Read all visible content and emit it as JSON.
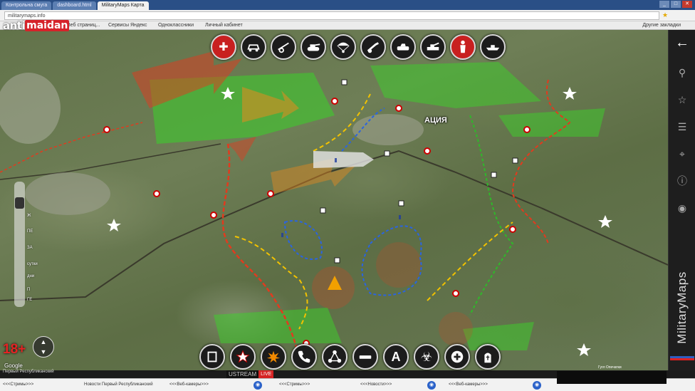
{
  "browser": {
    "tabs": [
      {
        "label": "Контрольна смуга"
      },
      {
        "label": "dashboard.html"
      },
      {
        "label": "MilitaryMaps Карта"
      }
    ],
    "address": "militarymaps.info",
    "bookmarks": [
      {
        "label": "Веб страниц..."
      },
      {
        "label": "Сервисы Яндекс"
      },
      {
        "label": "Одноклассники"
      },
      {
        "label": "Личный кабинет"
      }
    ],
    "other_bookmarks": "Другие закладки"
  },
  "logo": {
    "part1": "anti",
    "part2": "maidan"
  },
  "map": {
    "city_label": "АЦИЯ",
    "colors": {
      "green_zone": "#3bd12a",
      "red_zone": "#e23a1e",
      "yellow_route": "#f2c200",
      "blue_route": "#2a64e0"
    },
    "zoom_labels": [
      "Ж",
      "ПЕ",
      "ЗА",
      "сутки",
      "дни",
      "П",
      "ГЕ"
    ],
    "google": "Google",
    "status": "Первый Республиканский",
    "attribution": "Гугл  Опечатки"
  },
  "toolbar_top": [
    {
      "icon": "first-aid-icon"
    },
    {
      "icon": "car-icon"
    },
    {
      "icon": "artillery-icon"
    },
    {
      "icon": "tank-icon"
    },
    {
      "icon": "paratrooper-icon"
    },
    {
      "icon": "howitzer-icon"
    },
    {
      "icon": "armored-vehicle-icon"
    },
    {
      "icon": "apc-icon"
    },
    {
      "icon": "soldier-icon"
    },
    {
      "icon": "boat-icon"
    }
  ],
  "toolbar_bottom": [
    {
      "icon": "square-icon"
    },
    {
      "icon": "star-icon"
    },
    {
      "icon": "explosion-icon"
    },
    {
      "icon": "phone-icon"
    },
    {
      "icon": "network-icon"
    },
    {
      "icon": "minus-icon"
    },
    {
      "icon": "letter-a-icon",
      "text": "A"
    },
    {
      "icon": "biohazard-icon"
    },
    {
      "icon": "plus-icon"
    },
    {
      "icon": "cemetery-icon"
    }
  ],
  "sidebar": {
    "brand": "MilitaryMaps",
    "icons": [
      "back-arrow-icon",
      "location-pin-icon",
      "star-icon",
      "layers-icon",
      "navigation-icon",
      "info-icon",
      "flag-icon"
    ]
  },
  "age_rating": "18+",
  "stream": {
    "brand": "USTREAM",
    "live": "LIVE"
  },
  "ticker": {
    "items": [
      "<<<Стримы>>>",
      "Новости Первый Республиканский",
      "<<<Веб-камеры>>>",
      "<<<Стримы>>>",
      "<<<Новости>>>",
      "<<<Веб-камеры>>>"
    ]
  }
}
